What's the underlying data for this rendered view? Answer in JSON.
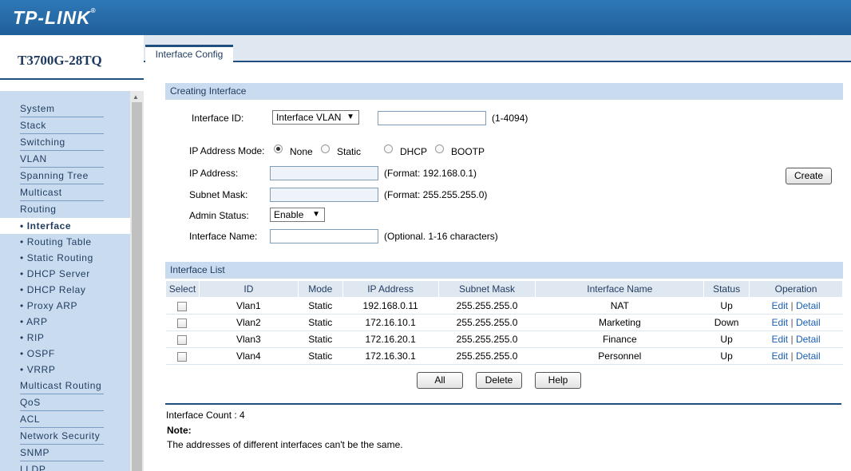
{
  "brand": {
    "logo": "TP-LINK",
    "reg": "®",
    "model": "T3700G-28TQ"
  },
  "nav": {
    "items_top": [
      "System",
      "Stack",
      "Switching",
      "VLAN",
      "Spanning Tree",
      "Multicast",
      "Routing"
    ],
    "routing_subitems": [
      "• Interface",
      "• Routing Table",
      "• Static Routing",
      "• DHCP Server",
      "• DHCP Relay",
      "• Proxy ARP",
      "• ARP",
      "• RIP",
      "• OSPF",
      "• VRRP"
    ],
    "items_bottom": [
      "Multicast Routing",
      "QoS",
      "ACL",
      "Network Security",
      "SNMP",
      "LLDP"
    ],
    "active": "• Interface"
  },
  "tab": {
    "label": "Interface Config"
  },
  "creating": {
    "title": "Creating Interface",
    "interface_id_label": "Interface ID:",
    "interface_id_select": "Interface VLAN",
    "interface_id_hint": "(1-4094)",
    "ip_mode_label": "IP Address Mode:",
    "ip_modes": [
      "None",
      "Static",
      "DHCP",
      "BOOTP"
    ],
    "ip_mode_selected": "None",
    "ip_address_label": "IP Address:",
    "ip_address_hint": "(Format: 192.168.0.1)",
    "subnet_label": "Subnet Mask:",
    "subnet_hint": "(Format: 255.255.255.0)",
    "admin_status_label": "Admin Status:",
    "admin_status_value": "Enable",
    "name_label": "Interface Name:",
    "name_hint": "(Optional. 1-16 characters)",
    "create_button": "Create"
  },
  "list": {
    "title": "Interface List",
    "columns": [
      "Select",
      "ID",
      "Mode",
      "IP Address",
      "Subnet Mask",
      "Interface Name",
      "Status",
      "Operation"
    ],
    "rows": [
      {
        "id": "Vlan1",
        "mode": "Static",
        "ip": "192.168.0.11",
        "mask": "255.255.255.0",
        "name": "NAT",
        "status": "Up"
      },
      {
        "id": "Vlan2",
        "mode": "Static",
        "ip": "172.16.10.1",
        "mask": "255.255.255.0",
        "name": "Marketing",
        "status": "Down"
      },
      {
        "id": "Vlan3",
        "mode": "Static",
        "ip": "172.16.20.1",
        "mask": "255.255.255.0",
        "name": "Finance",
        "status": "Up"
      },
      {
        "id": "Vlan4",
        "mode": "Static",
        "ip": "172.16.30.1",
        "mask": "255.255.255.0",
        "name": "Personnel",
        "status": "Up"
      }
    ],
    "edit_label": "Edit",
    "separator": "|",
    "detail_label": "Detail",
    "buttons": {
      "all": "All",
      "delete": "Delete",
      "help": "Help"
    }
  },
  "footer": {
    "count_label": "Interface Count : 4",
    "note_label": "Note:",
    "note_text": "The addresses of different interfaces can't be the same."
  }
}
